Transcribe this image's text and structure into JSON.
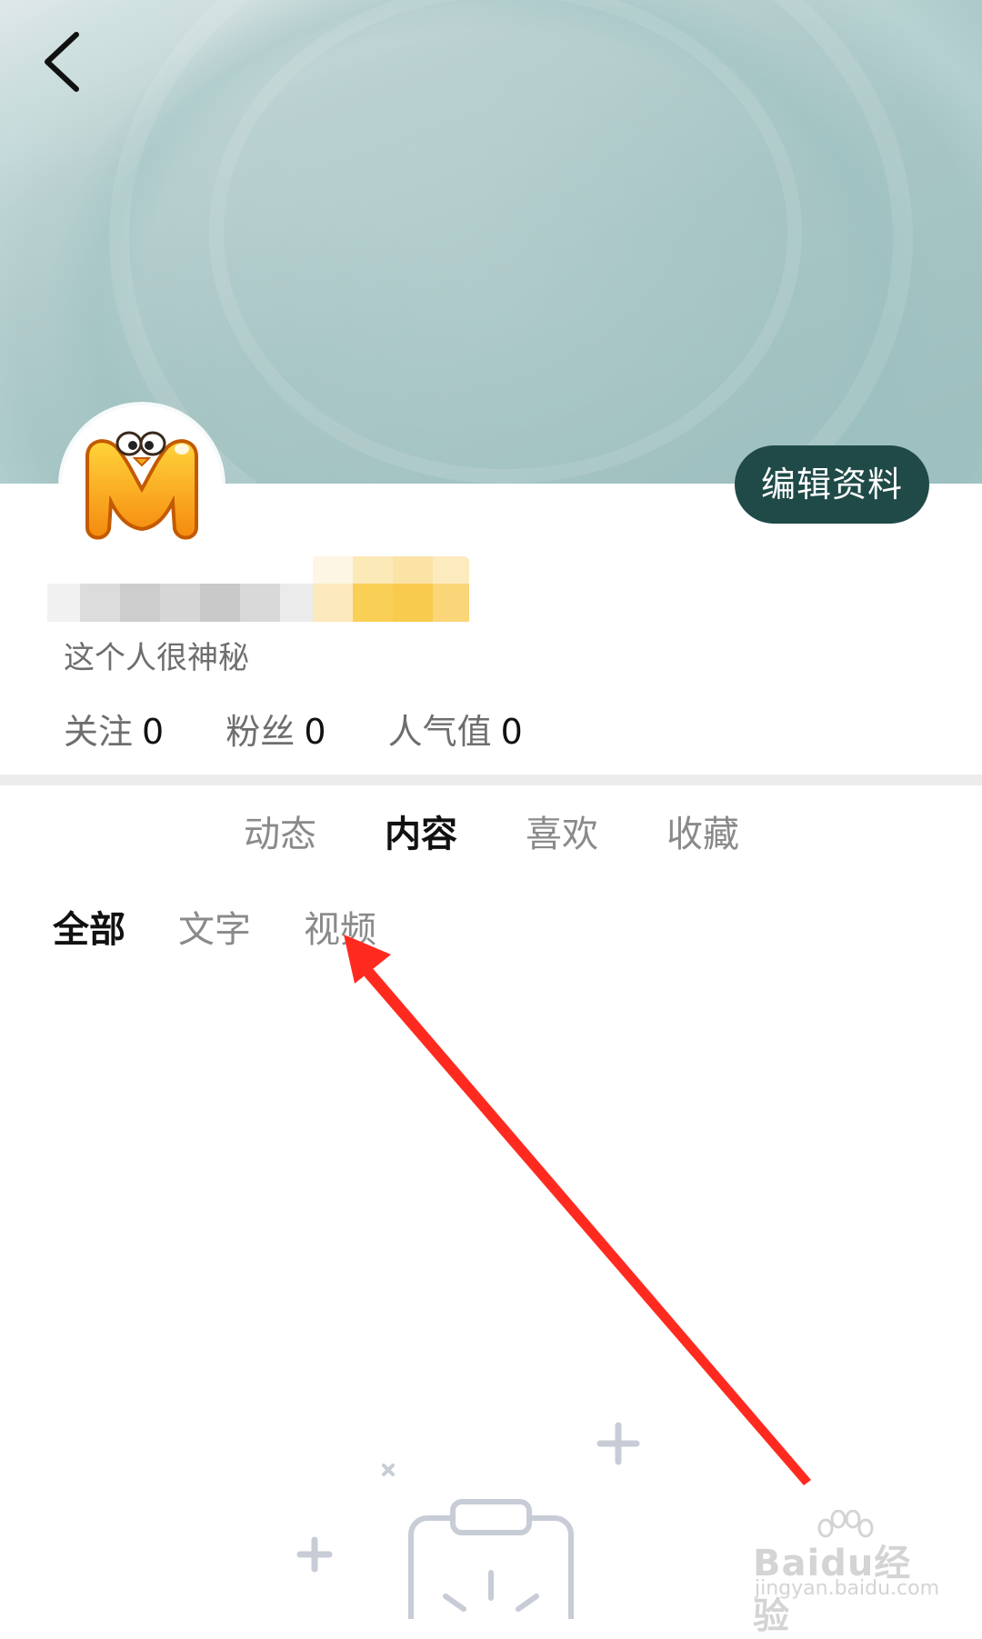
{
  "header": {
    "edit_profile_label": "编辑资料"
  },
  "profile": {
    "bio": "这个人很神秘",
    "stats": [
      {
        "label": "关注",
        "value": "0"
      },
      {
        "label": "粉丝",
        "value": "0"
      },
      {
        "label": "人气值",
        "value": "0"
      }
    ]
  },
  "tabs": [
    {
      "label": "动态",
      "active": false
    },
    {
      "label": "内容",
      "active": true
    },
    {
      "label": "喜欢",
      "active": false
    },
    {
      "label": "收藏",
      "active": false
    }
  ],
  "subtabs": [
    {
      "label": "全部",
      "active": true
    },
    {
      "label": "文字",
      "active": false
    },
    {
      "label": "视频",
      "active": false
    }
  ],
  "watermark": {
    "brand": "Baidu经验",
    "url": "jingyan.baidu.com"
  },
  "colors": {
    "accent_button": "#1f4a48",
    "annotation_arrow": "#ff2a1f",
    "avatar_yellow": "#f7a81b"
  },
  "icons": {
    "back": "back-arrow-icon",
    "empty": "empty-clipboard-icon"
  }
}
